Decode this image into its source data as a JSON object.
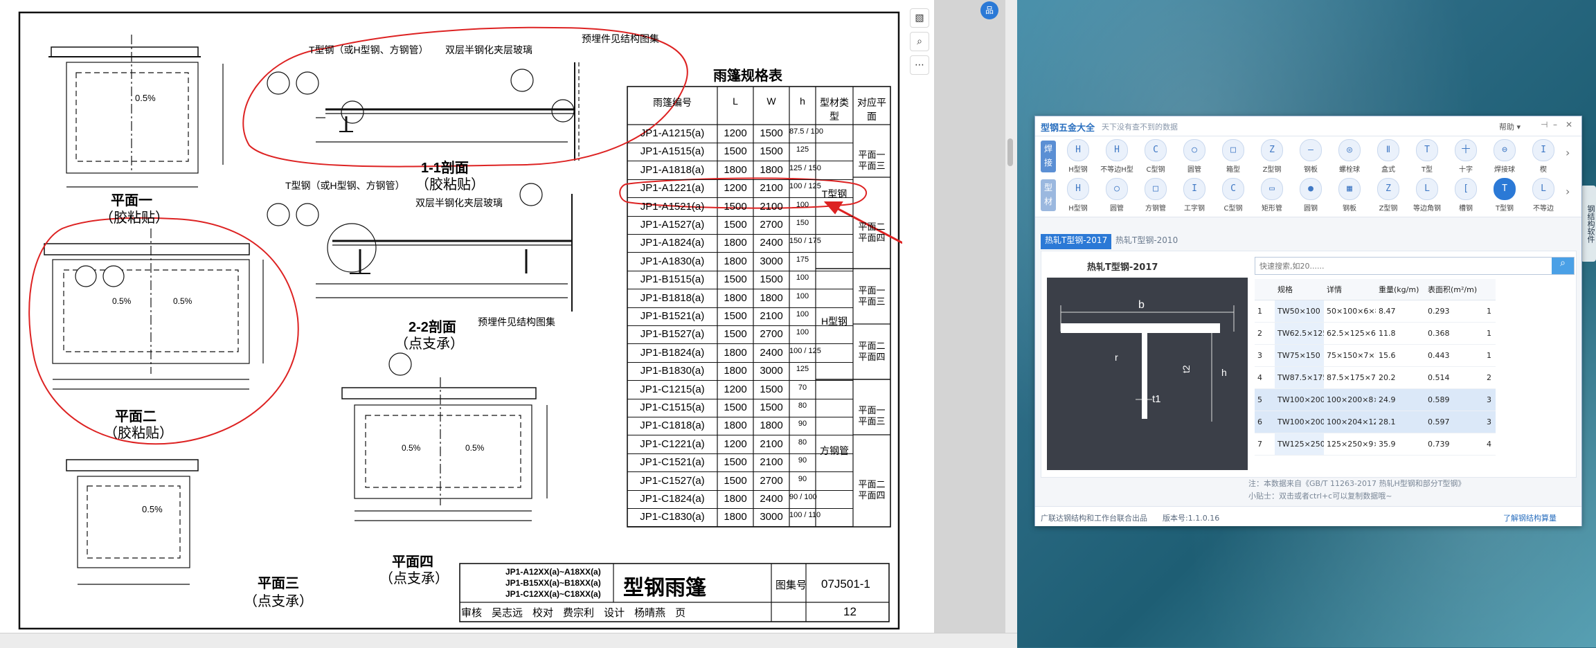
{
  "viewer": {
    "tools": [
      "edit-image-icon",
      "zoom-icon",
      "more-icon"
    ],
    "blue_button": "品"
  },
  "drawing": {
    "table_title": "雨篷规格表",
    "table_headers": [
      "雨篷编号",
      "L",
      "W",
      "h",
      "型材类型",
      "对应平面"
    ],
    "rows": [
      [
        "JP1-A1215(a)",
        "1200",
        "1500",
        "87.5 / 100"
      ],
      [
        "JP1-A1515(a)",
        "1500",
        "1500",
        "125"
      ],
      [
        "JP1-A1818(a)",
        "1800",
        "1800",
        "125 / 150"
      ],
      [
        "JP1-A1221(a)",
        "1200",
        "2100",
        "100 / 125"
      ],
      [
        "JP1-A1521(a)",
        "1500",
        "2100",
        "100"
      ],
      [
        "JP1-A1527(a)",
        "1500",
        "2700",
        "150"
      ],
      [
        "JP1-A1824(a)",
        "1800",
        "2400",
        "150 / 175"
      ],
      [
        "JP1-A1830(a)",
        "1800",
        "3000",
        "175"
      ],
      [
        "JP1-B1515(a)",
        "1500",
        "1500",
        "100"
      ],
      [
        "JP1-B1818(a)",
        "1800",
        "1800",
        "100"
      ],
      [
        "JP1-B1521(a)",
        "1500",
        "2100",
        "100"
      ],
      [
        "JP1-B1527(a)",
        "1500",
        "2700",
        "100"
      ],
      [
        "JP1-B1824(a)",
        "1800",
        "2400",
        "100 / 125"
      ],
      [
        "JP1-B1830(a)",
        "1800",
        "3000",
        "125"
      ],
      [
        "JP1-C1215(a)",
        "1200",
        "1500",
        "70"
      ],
      [
        "JP1-C1515(a)",
        "1500",
        "1500",
        "80"
      ],
      [
        "JP1-C1818(a)",
        "1800",
        "1800",
        "90"
      ],
      [
        "JP1-C1221(a)",
        "1200",
        "2100",
        "80"
      ],
      [
        "JP1-C1521(a)",
        "1500",
        "2100",
        "90"
      ],
      [
        "JP1-C1527(a)",
        "1500",
        "2700",
        "90"
      ],
      [
        "JP1-C1824(a)",
        "1800",
        "2400",
        "90 / 100"
      ],
      [
        "JP1-C1830(a)",
        "1800",
        "3000",
        "100 / 110"
      ]
    ],
    "type_groups": [
      {
        "type": "T型钢",
        "planes": [
          "平面一 平面三",
          "平面二 平面四"
        ]
      },
      {
        "type": "H型钢",
        "planes": [
          "平面一 平面三",
          "平面二 平面四"
        ]
      },
      {
        "type": "方钢管",
        "planes": [
          "平面一 平面三",
          "平面二 平面四"
        ]
      }
    ],
    "section1_title": "1-1剖面",
    "section1_sub": "（胶粘贴）",
    "section2_title": "2-2剖面",
    "section2_sub": "（点支承）",
    "label_tsteel": "T型钢（或H型钢、方钢管）",
    "label_glass": "双层半钢化夹层玻璃",
    "label_embed": "预埋件见结构图集",
    "plan1": [
      "平面一",
      "（胶粘贴）"
    ],
    "plan2": [
      "平面二",
      "（胶粘贴）"
    ],
    "plan3": [
      "平面三",
      "（点支承）"
    ],
    "plan4": [
      "平面四",
      "（点支承）"
    ],
    "slope": "0.5%",
    "title_block": {
      "codes": [
        "JP1-A12XX(a)~A18XX(a)",
        "JP1-B15XX(a)~B18XX(a)",
        "JP1-C12XX(a)~C18XX(a)"
      ],
      "name": "型钢雨篷",
      "atlas_label": "图集号",
      "atlas_no": "07J501-1",
      "row2": [
        "审核",
        "吴志远",
        "校对",
        "费宗利",
        "设计",
        "杨晴燕",
        "页"
      ],
      "page": "12"
    }
  },
  "app": {
    "name": "型钢五金大全",
    "slogan": "天下没有查不到的数据",
    "help": "帮助",
    "side_tabs": [
      "焊接",
      "型材"
    ],
    "row1": [
      {
        "icon": "H",
        "label": "H型钢"
      },
      {
        "icon": "H",
        "label": "不等边H型"
      },
      {
        "icon": "C",
        "label": "C型钢"
      },
      {
        "icon": "○",
        "label": "圆管"
      },
      {
        "icon": "□",
        "label": "箱型"
      },
      {
        "icon": "Z",
        "label": "Z型钢"
      },
      {
        "icon": "—",
        "label": "钢板"
      },
      {
        "icon": "◎",
        "label": "螺栓球"
      },
      {
        "icon": "Ⅱ",
        "label": "盒式"
      },
      {
        "icon": "T",
        "label": "T型"
      },
      {
        "icon": "十",
        "label": "十字"
      },
      {
        "icon": "⊖",
        "label": "焊接球"
      },
      {
        "icon": "I",
        "label": "楔"
      }
    ],
    "row2": [
      {
        "icon": "H",
        "label": "H型钢"
      },
      {
        "icon": "○",
        "label": "圆管"
      },
      {
        "icon": "□",
        "label": "方钢管"
      },
      {
        "icon": "I",
        "label": "工字钢"
      },
      {
        "icon": "C",
        "label": "C型钢"
      },
      {
        "icon": "▭",
        "label": "矩形管"
      },
      {
        "icon": "●",
        "label": "圆钢"
      },
      {
        "icon": "▦",
        "label": "钢板"
      },
      {
        "icon": "Z",
        "label": "Z型钢"
      },
      {
        "icon": "L",
        "label": "等边角钢"
      },
      {
        "icon": "[",
        "label": "槽钢"
      },
      {
        "icon": "T",
        "label": "T型钢"
      },
      {
        "icon": "L",
        "label": "不等边"
      }
    ],
    "sub_tabs": [
      "热轧T型钢-2017",
      "热轧T型钢-2010"
    ],
    "image_title": "热轧T型钢-2017",
    "dims": [
      "b",
      "t2",
      "h",
      "t1",
      "r"
    ],
    "search_placeholder": "快速搜索,如20......",
    "columns": [
      "规格",
      "详情",
      "重量(kg/m)",
      "表面积(m²/m)"
    ],
    "rows": [
      [
        "1",
        "TW50×100",
        "50×100×6×8",
        "8.47",
        "0.293",
        "1"
      ],
      [
        "2",
        "TW62.5×125",
        "62.5×125×6.5...",
        "11.8",
        "0.368",
        "1"
      ],
      [
        "3",
        "TW75×150",
        "75×150×7×10",
        "15.6",
        "0.443",
        "1"
      ],
      [
        "4",
        "TW87.5×175",
        "87.5×175×7.5...",
        "20.2",
        "0.514",
        "2"
      ],
      [
        "5",
        "TW100×200",
        "100×200×8×12",
        "24.9",
        "0.589",
        "3"
      ],
      [
        "6",
        "TW100×200",
        "100×204×12...",
        "28.1",
        "0.597",
        "3"
      ],
      [
        "7",
        "TW125×250",
        "125×250×9×14",
        "35.9",
        "0.739",
        "4"
      ]
    ],
    "note1": "注：本数据来自《GB/T 11263-2017 热轧H型钢和部分T型钢》",
    "note2": "小贴士：双击或者ctrl+c可以复制数据哦~",
    "footer_left": "广联达钢结构和工作台联合出品",
    "footer_version": "版本号:1.1.0.16",
    "footer_right": "了解钢结构算量"
  },
  "desktop_icon_label": "钢结构软件"
}
